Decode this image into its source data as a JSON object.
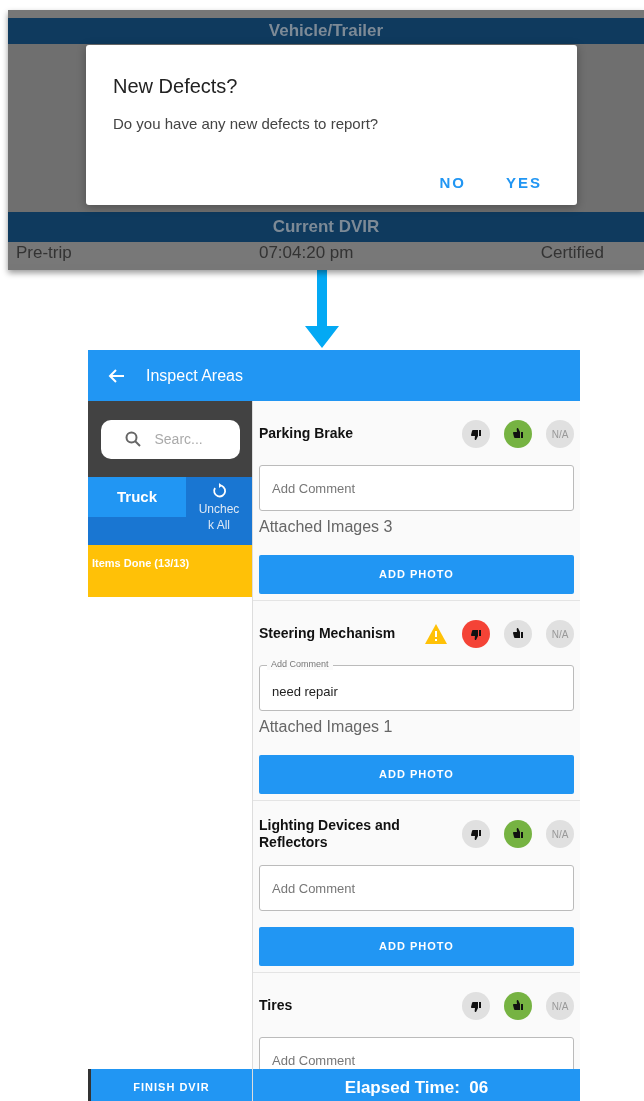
{
  "background_screen": {
    "header": "Vehicle/Trailer",
    "section": "Current DVIR",
    "row": [
      "Pre-trip",
      "07:04:20 pm",
      "Certified"
    ]
  },
  "dialog": {
    "title": "New Defects?",
    "message": "Do you have any new defects to report?",
    "buttons": [
      "NO",
      "YES"
    ]
  },
  "app_bar": {
    "title": "Inspect Areas"
  },
  "sidebar": {
    "search": {
      "placeholder": "Searc..."
    },
    "tabs": [
      {
        "label": "Truck",
        "selected": true
      }
    ],
    "uncheck_button": "Uncheck All",
    "progress": "Items Done (13/13)",
    "finish_button": "FINISH DVIR"
  },
  "items": [
    {
      "name": "Parking Brake",
      "warning": false,
      "ratings": [
        {
          "kind": "fail",
          "selected": false
        },
        {
          "kind": "pass",
          "selected": true
        },
        {
          "kind": "na",
          "label": "N/A",
          "selected": false
        }
      ],
      "comment": {
        "placeholder": "Add Comment"
      },
      "attached": "Attached Images 3",
      "button": "ADD PHOTO"
    },
    {
      "name": "Steering Mechanism",
      "warning": true,
      "ratings": [
        {
          "kind": "fail",
          "selected": true
        },
        {
          "kind": "pass",
          "selected": false
        },
        {
          "kind": "na",
          "label": "N/A",
          "selected": false
        }
      ],
      "comment": {
        "placeholder": "Add Comment",
        "value": "need repair"
      },
      "attached": "Attached Images 1",
      "button": "ADD PHOTO"
    },
    {
      "name": "Lighting Devices and Reflectors",
      "warning": false,
      "ratings": [
        {
          "kind": "fail",
          "selected": false
        },
        {
          "kind": "pass",
          "selected": true
        },
        {
          "kind": "na",
          "label": "N/A",
          "selected": false
        }
      ],
      "comment": {
        "placeholder": "Add Comment"
      },
      "button": "ADD PHOTO"
    },
    {
      "name": "Tires",
      "warning": false,
      "ratings": [
        {
          "kind": "fail",
          "selected": false
        },
        {
          "kind": "pass",
          "selected": true
        },
        {
          "kind": "na",
          "label": "N/A",
          "selected": false
        }
      ],
      "comment": {
        "placeholder": "Add Comment"
      }
    }
  ],
  "status_bar": {
    "elapsed": "Elapsed Time:  06"
  }
}
